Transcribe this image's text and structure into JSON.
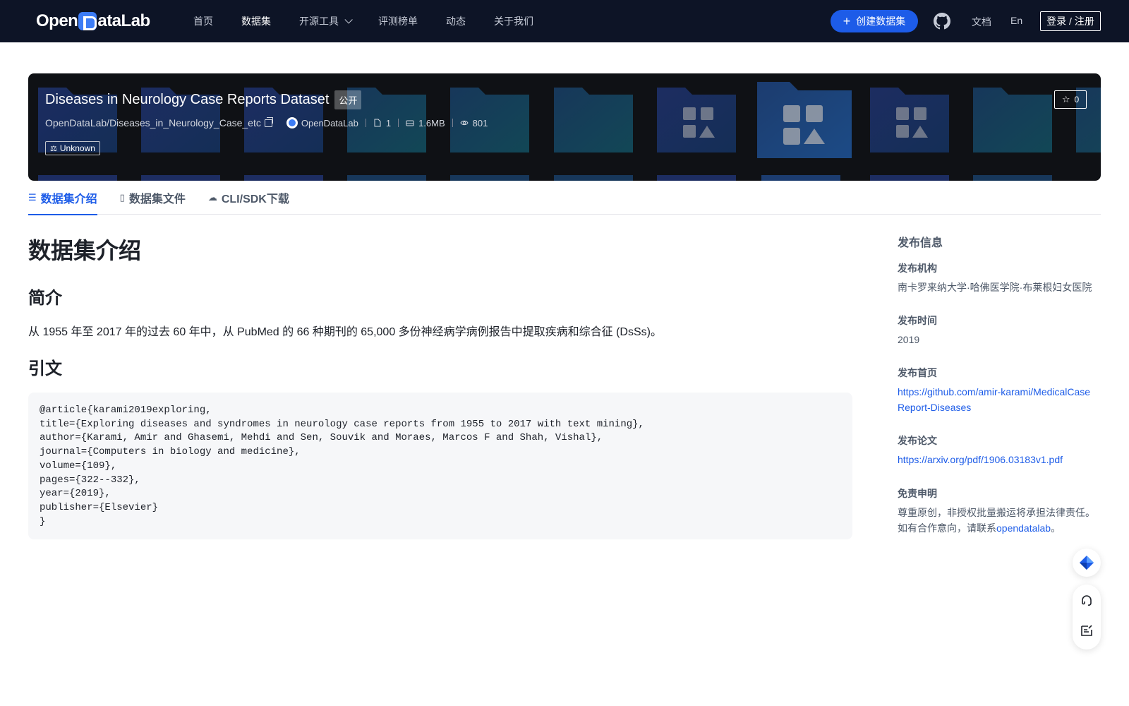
{
  "nav": {
    "logo": "OpenDataLab",
    "links": [
      "首页",
      "数据集",
      "开源工具",
      "评测榜单",
      "动态",
      "关于我们"
    ],
    "active": "数据集",
    "create_label": "创建数据集",
    "docs_label": "文档",
    "lang_label": "En",
    "login_label": "登录 / 注册"
  },
  "banner": {
    "title": "Diseases in Neurology Case Reports Dataset",
    "visibility": "公开",
    "path": "OpenDataLab/Diseases_in_Neurology_Case_etc",
    "org": "OpenDataLab",
    "file_count": "1",
    "size": "1.6MB",
    "views": "801",
    "license": "Unknown",
    "stars": "0"
  },
  "tabs": [
    {
      "label": "数据集介绍",
      "icon": "database-icon"
    },
    {
      "label": "数据集文件",
      "icon": "file-icon"
    },
    {
      "label": "CLI/SDK下载",
      "icon": "cloud-download-icon"
    }
  ],
  "content": {
    "heading": "数据集介绍",
    "intro_heading": "简介",
    "intro_text": "从 1955 年至 2017 年的过去 60 年中，从 PubMed 的 66 种期刊的 65,000 多份神经病学病例报告中提取疾病和综合征 (DsSs)。",
    "citation_heading": "引文",
    "citation": "@article{karami2019exploring,\ntitle={Exploring diseases and syndromes in neurology case reports from 1955 to 2017 with text mining},\nauthor={Karami, Amir and Ghasemi, Mehdi and Sen, Souvik and Moraes, Marcos F and Shah, Vishal},\njournal={Computers in biology and medicine},\nvolume={109},\npages={322--332},\nyear={2019},\npublisher={Elsevier}\n}"
  },
  "sidebar": {
    "title": "发布信息",
    "org_label": "发布机构",
    "org_value": "南卡罗来纳大学·哈佛医学院·布莱根妇女医院",
    "time_label": "发布时间",
    "time_value": "2019",
    "home_label": "发布首页",
    "home_value": "https://github.com/amir-karami/MedicalCaseReport-Diseases",
    "paper_label": "发布论文",
    "paper_value": "https://arxiv.org/pdf/1906.03183v1.pdf",
    "disclaimer_label": "免责申明",
    "disclaimer_line1": "尊重原创，非授权批量搬运将承担法律责任。",
    "disclaimer_line2_pre": "如有合作意向，请联系",
    "disclaimer_link": "opendatalab",
    "disclaimer_end": "。"
  },
  "colors": {
    "nav_bg": "#0d1426",
    "accent": "#1d5ce8",
    "banner_bg": "#0f1115",
    "code_bg": "#f6f7f9"
  }
}
